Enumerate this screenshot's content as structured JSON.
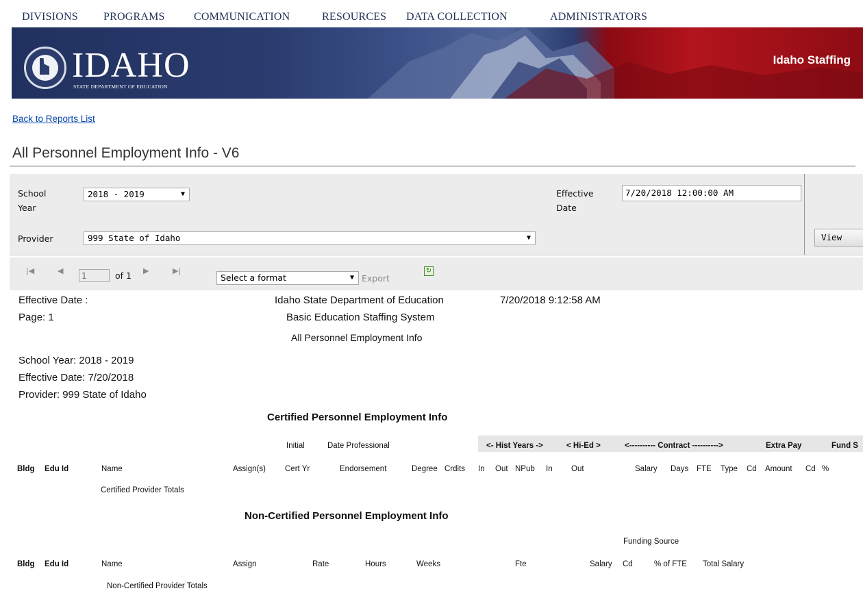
{
  "nav": {
    "items": [
      "DIVISIONS",
      "PROGRAMS",
      "COMMUNICATION",
      "RESOURCES",
      "DATA COLLECTION",
      "ADMINISTRATORS"
    ]
  },
  "banner": {
    "logo_text": "IDAHO",
    "logo_subtitle": "STATE DEPARTMENT OF EDUCATION",
    "app_title": "Idaho Staffing"
  },
  "back_link": "Back to Reports List",
  "page_title": "All Personnel Employment Info - V6",
  "params": {
    "school_year_label_1": "School",
    "school_year_label_2": "Year",
    "school_year_value": "2018 - 2019",
    "provider_label": "Provider",
    "provider_value": "999  State of Idaho",
    "effective_label_1": "Effective",
    "effective_label_2": "Date",
    "effective_value": "7/20/2018 12:00:00 AM",
    "view_button": "View Report"
  },
  "toolbar": {
    "first_icon": "first-page-icon",
    "prev_icon": "previous-page-icon",
    "page_value": "1",
    "of_text": "of 1",
    "next_icon": "next-page-icon",
    "last_icon": "last-page-icon",
    "format_value": "Select a format",
    "export_label": "Export",
    "refresh_icon": "refresh-icon"
  },
  "report": {
    "effective_date_label": "Effective Date :",
    "page_label": "Page:  1",
    "org": "Idaho State Department of Education",
    "system": "Basic Education Staffing System",
    "report_name": "All Personnel Employment Info",
    "run_timestamp": "7/20/2018 9:12:58 AM",
    "school_year": "School Year: 2018 - 2019",
    "effective_date": "Effective Date: 7/20/2018",
    "provider": "Provider: 999  State of Idaho",
    "certified_heading": "Certified Personnel Employment Info",
    "certified_group_headers": {
      "initial": "Initial",
      "date_professional": "Date Professional",
      "hist_years": "<- Hist Years ->",
      "hi_ed": "< Hi-Ed >",
      "contract": "<---------- Contract ---------->",
      "extra_pay": "Extra Pay",
      "fund": "Fund S"
    },
    "certified_columns": {
      "bldg": "Bldg",
      "edu_id": "Edu Id",
      "name": "Name",
      "assigns": "Assign(s)",
      "cert_yr": "Cert Yr",
      "endorsement": "Endorsement",
      "degree": "Degree",
      "crdits": "Crdits",
      "in": "In",
      "out": "Out",
      "npub": "NPub",
      "hied_in": "In",
      "hied_out": "Out",
      "salary": "Salary",
      "days": "Days",
      "fte": "FTE",
      "type": "Type",
      "cd": "Cd",
      "amount": "Amount",
      "fund_cd": "Cd",
      "pct": "%"
    },
    "certified_totals": "Certified Provider Totals",
    "noncert_heading": "Non-Certified Personnel Employment Info",
    "noncert_group_header": "Funding Source",
    "noncert_columns": {
      "bldg": "Bldg",
      "edu_id": "Edu Id",
      "name": "Name",
      "assign": "Assign",
      "rate": "Rate",
      "hours": "Hours",
      "weeks": "Weeks",
      "fte": "Fte",
      "salary": "Salary",
      "cd": "Cd",
      "pct_fte": "% of FTE",
      "total_salary": "Total Salary"
    },
    "noncert_totals": "Non-Certified Provider Totals"
  }
}
